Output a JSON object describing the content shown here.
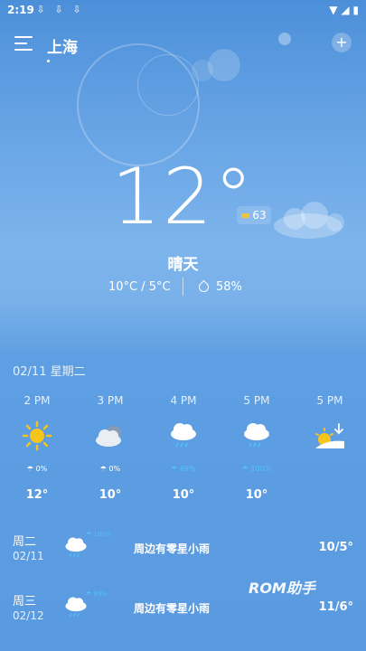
{
  "status_bar": {
    "time": "2:19",
    "download_icons": [
      "download-icon",
      "download-icon",
      "download-icon"
    ],
    "signal_icons": [
      "wifi-icon",
      "cell-signal-icon",
      "battery-icon"
    ]
  },
  "header": {
    "city": "上海",
    "menu_icon": "menu-icon",
    "add_icon": "plus-icon"
  },
  "current": {
    "temperature": "12°",
    "aqi": "63",
    "condition": "晴天",
    "range": "10°C / 5°C",
    "humidity": "58%"
  },
  "date_label": "02/11 星期二",
  "hourly": [
    {
      "time": "2 PM",
      "icon": "sun-icon",
      "precip": "☂ 0%",
      "precip_blue": false,
      "temp": "12°"
    },
    {
      "time": "3 PM",
      "icon": "cloudy-icon",
      "precip": "☂ 0%",
      "precip_blue": false,
      "temp": "10°"
    },
    {
      "time": "4 PM",
      "icon": "rain-icon",
      "precip": "☂ 69%",
      "precip_blue": true,
      "temp": "10°"
    },
    {
      "time": "5 PM",
      "icon": "rain-icon",
      "precip": "☂ 100%",
      "precip_blue": true,
      "temp": "10°"
    },
    {
      "time": "5 PM",
      "icon": "sunset-icon",
      "precip": "",
      "precip_blue": false,
      "temp": ""
    }
  ],
  "daily": [
    {
      "day": "周二",
      "date": "02/11",
      "precip": "☂ 100%",
      "condition": "周边有零星小雨",
      "temps": "10/5°"
    },
    {
      "day": "周三",
      "date": "02/12",
      "precip": "☂ 99%",
      "condition": "周边有零星小雨",
      "temps": "11/6°"
    }
  ],
  "watermark": "ROM助手",
  "colors": {
    "rain_blue": "#4fc3ff",
    "sun_yellow": "#f5c51c"
  }
}
